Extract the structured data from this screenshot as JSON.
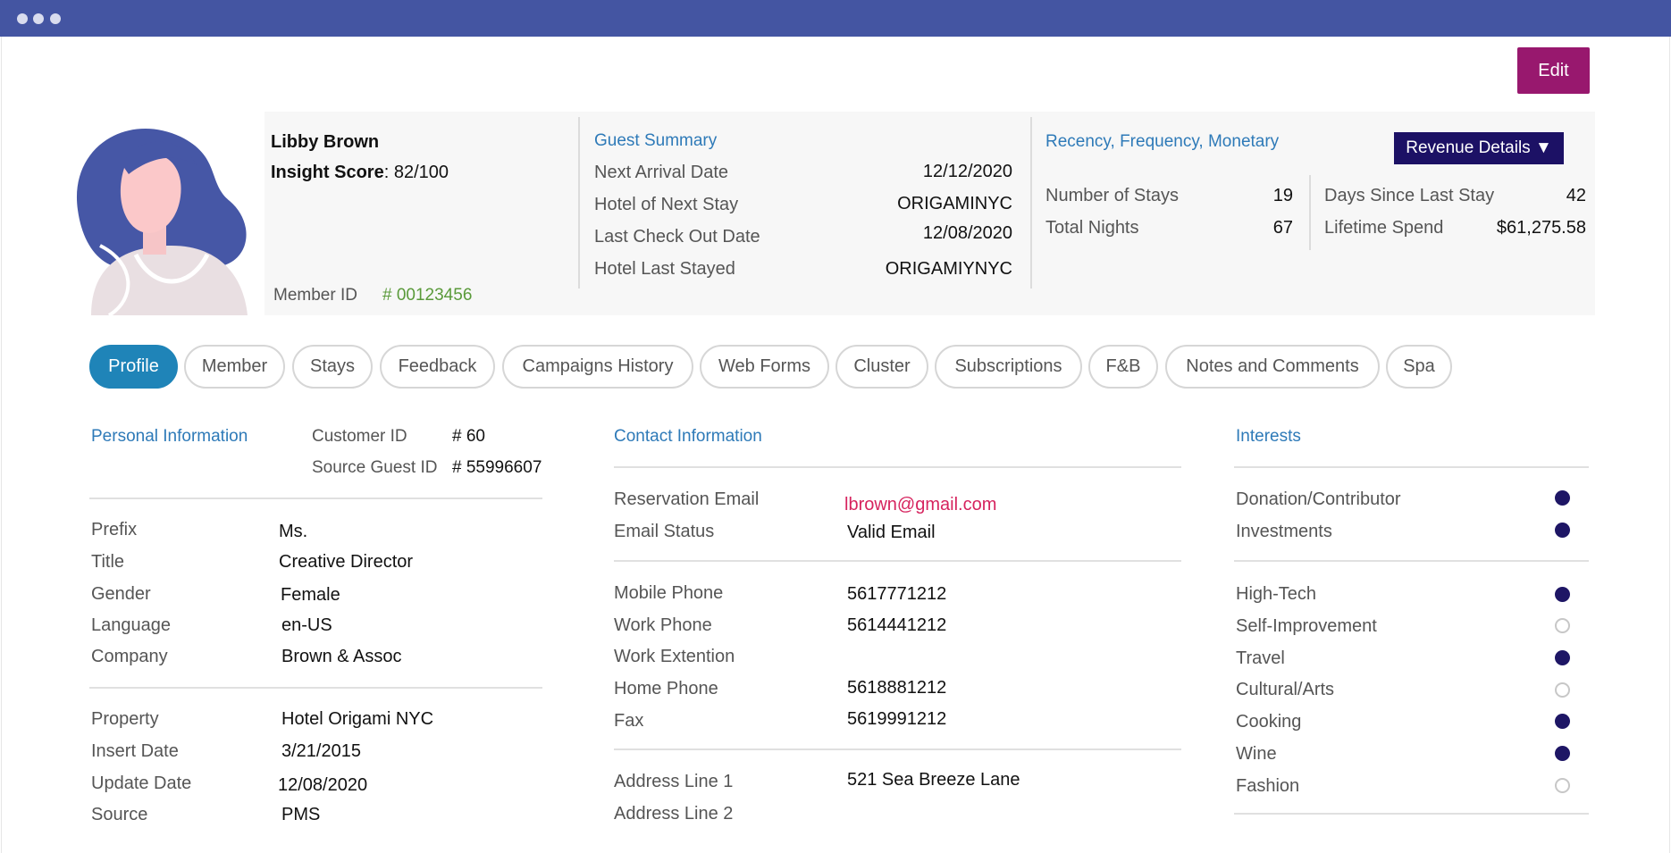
{
  "edit_label": "Edit",
  "guest": {
    "name": "Libby Brown",
    "insight_score_label": "Insight Score",
    "insight_score_value": ": 82/100",
    "member_id_label": "Member ID",
    "member_id_value": "# 00123456"
  },
  "guest_summary": {
    "title": "Guest Summary",
    "rows": [
      {
        "label": "Next Arrival Date",
        "value": "12/12/2020"
      },
      {
        "label": "Hotel of Next Stay",
        "value": "ORIGAMINYC"
      },
      {
        "label": "Last Check Out Date",
        "value": "12/08/2020"
      },
      {
        "label": "Hotel Last Stayed",
        "value": "ORIGAMIYNYC"
      }
    ]
  },
  "rfm": {
    "title": "Recency, Frequency, Monetary",
    "button_label": "Revenue Details ▼",
    "left": [
      {
        "label": "Number of Stays",
        "value": "19"
      },
      {
        "label": "Total Nights",
        "value": "67"
      }
    ],
    "right": [
      {
        "label": "Days Since Last Stay",
        "value": "42"
      },
      {
        "label": "Lifetime Spend",
        "value": "$61,275.58"
      }
    ]
  },
  "tabs": [
    "Profile",
    "Member",
    "Stays",
    "Feedback",
    "Campaigns History",
    "Web Forms",
    "Cluster",
    "Subscriptions",
    "F&B",
    "Notes and Comments",
    "Spa"
  ],
  "personal": {
    "title": "Personal Information",
    "ids": [
      {
        "label": "Customer ID",
        "value": "# 60"
      },
      {
        "label": "Source Guest ID",
        "value": "# 55996607"
      }
    ],
    "group1": [
      {
        "label": "Prefix",
        "value": "Ms."
      },
      {
        "label": "Title",
        "value": "Creative Director"
      },
      {
        "label": "Gender",
        "value": "Female"
      },
      {
        "label": "Language",
        "value": "en-US"
      },
      {
        "label": "Company",
        "value": "Brown & Assoc"
      }
    ],
    "group2": [
      {
        "label": "Property",
        "value": "Hotel Origami NYC"
      },
      {
        "label": "Insert Date",
        "value": "3/21/2015"
      },
      {
        "label": "Update Date",
        "value": "12/08/2020"
      },
      {
        "label": "Source",
        "value": "PMS"
      }
    ]
  },
  "contact": {
    "title": "Contact Information",
    "email": [
      {
        "label": "Reservation Email",
        "value": "lbrown@gmail.com"
      },
      {
        "label": "Email Status",
        "value": "Valid Email"
      }
    ],
    "phones": [
      {
        "label": "Mobile Phone",
        "value": "5617771212"
      },
      {
        "label": "Work Phone",
        "value": "5614441212"
      },
      {
        "label": "Work Extention",
        "value": ""
      },
      {
        "label": "Home Phone",
        "value": "5618881212"
      },
      {
        "label": "Fax",
        "value": "5619991212"
      }
    ],
    "address": [
      {
        "label": "Address Line 1",
        "value": "521 Sea Breeze Lane"
      },
      {
        "label": "Address Line 2",
        "value": ""
      }
    ]
  },
  "interests": {
    "title": "Interests",
    "group1": [
      {
        "label": "Donation/Contributor",
        "selected": true
      },
      {
        "label": "Investments",
        "selected": true
      }
    ],
    "group2": [
      {
        "label": "High-Tech",
        "selected": true
      },
      {
        "label": "Self-Improvement",
        "selected": false
      },
      {
        "label": "Travel",
        "selected": true
      },
      {
        "label": "Cultural/Arts",
        "selected": false
      },
      {
        "label": "Cooking",
        "selected": true
      },
      {
        "label": "Wine",
        "selected": true
      },
      {
        "label": "Fashion",
        "selected": false
      }
    ]
  },
  "colors": {
    "titlebar": "#4455a2",
    "edit_button": "#98186e",
    "section_title": "#2e7ab8",
    "member_id": "#5a9a3a",
    "email": "#d6235e",
    "revenue_button": "#1c1165",
    "active_tab": "#1f84b8",
    "interest_on": "#1e1665"
  }
}
